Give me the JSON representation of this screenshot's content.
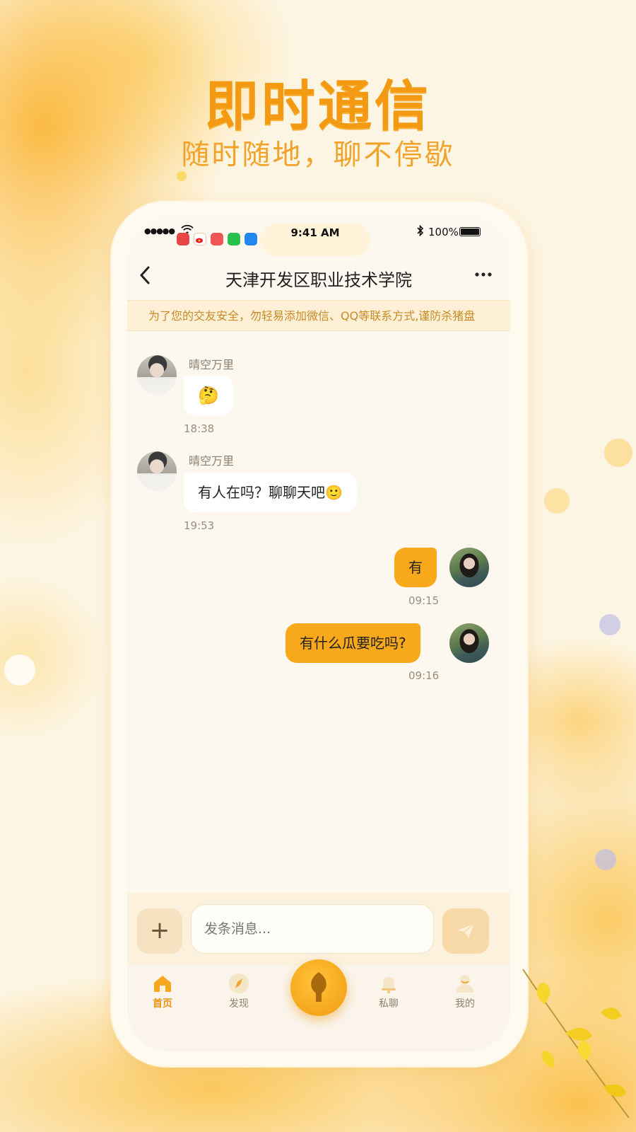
{
  "promo": {
    "headline": "即时通信",
    "subhead": "随时随地，聊不停歇"
  },
  "status_bar": {
    "signal": "●●●●●",
    "time": "9:41 AM",
    "battery": "100%"
  },
  "chat": {
    "title": "天津开发区职业技术学院",
    "back_icon": "chevron-left-icon",
    "more_icon": "more-horizontal-icon",
    "notice": "为了您的交友安全，勿轻易添加微信、QQ等联系方式,谨防杀猪盘"
  },
  "messages": [
    {
      "sender": "晴空万里",
      "text": "🤔",
      "time": "18:38",
      "direction": "in"
    },
    {
      "sender": "晴空万里",
      "text": "有人在吗？聊聊天吧🙂",
      "time": "19:53",
      "direction": "in"
    },
    {
      "sender": "",
      "text": "有",
      "time": "09:15",
      "direction": "out"
    },
    {
      "sender": "",
      "text": "有什么瓜要吃吗?",
      "time": "09:16",
      "direction": "out"
    }
  ],
  "composer": {
    "plus_label": "+",
    "placeholder": "发条消息..."
  },
  "tabbar": {
    "items": [
      {
        "label": "首页",
        "icon": "home-icon",
        "active": true
      },
      {
        "label": "发现",
        "icon": "compass-icon",
        "active": false
      },
      {
        "label": "",
        "icon": "center-leaf-icon",
        "active": false
      },
      {
        "label": "私聊",
        "icon": "bell-icon",
        "active": false
      },
      {
        "label": "我的",
        "icon": "profile-icon",
        "active": false
      }
    ]
  },
  "colors": {
    "accent": "#f7a81b",
    "headline": "#f39a12",
    "notice_text": "#c88a24"
  }
}
